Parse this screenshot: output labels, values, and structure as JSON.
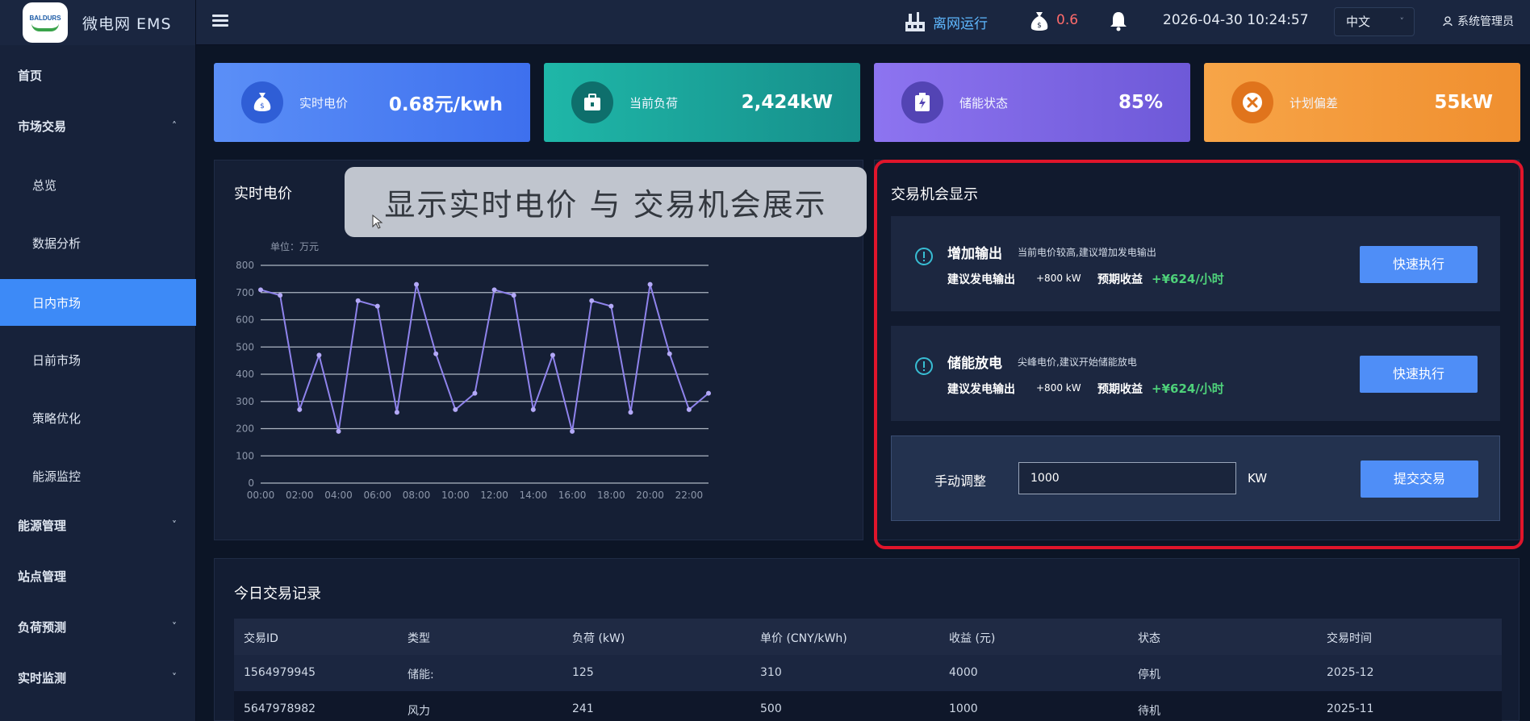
{
  "brand": {
    "logo_text": "BALDURS",
    "title": "微电网 EMS"
  },
  "header": {
    "status": "离网运行",
    "value": "0.6",
    "datetime": "2026-04-30 10:24:57",
    "language": "中文",
    "user": "系统管理员",
    "icons": [
      "menu-icon",
      "power-grid-icon",
      "money-bag-icon",
      "bell-icon",
      "chevron-down-icon",
      "user-icon"
    ]
  },
  "sidebar": {
    "items": [
      {
        "label": "首页"
      },
      {
        "label": "市场交易",
        "arrow": "^"
      },
      {
        "label": "总览"
      },
      {
        "label": "数据分析"
      },
      {
        "label": "日内市场"
      },
      {
        "label": "日前市场"
      },
      {
        "label": "策略优化"
      },
      {
        "label": "能源监控"
      },
      {
        "label": "能源管理",
        "arrow": "v"
      },
      {
        "label": "站点管理"
      },
      {
        "label": "负荷预测",
        "arrow": "v"
      },
      {
        "label": "实时监测",
        "arrow": "v"
      }
    ]
  },
  "kpis": [
    {
      "label": "实时电价",
      "value": "0.68元/kwh",
      "icon": "money-bag-icon",
      "color": "#4a7ef2"
    },
    {
      "label": "当前负荷",
      "value": "2,424kW",
      "icon": "load-box-icon",
      "color": "#1aa69a"
    },
    {
      "label": "储能状态",
      "value": "85%",
      "icon": "battery-bolt-icon",
      "color": "#7c66e4"
    },
    {
      "label": "计划偏差",
      "value": "55kW",
      "icon": "close-circle-icon",
      "color": "#f39a3b"
    }
  ],
  "chart_panel": {
    "title": "实时电价"
  },
  "overlay_caption": "显示实时电价 与 交易机会展示",
  "chart_data": {
    "type": "line",
    "title": "",
    "unit_label": "单位：万元",
    "xlabel": "",
    "ylabel": "",
    "ylim": [
      0,
      800
    ],
    "y_ticks": [
      0,
      100,
      200,
      300,
      400,
      500,
      600,
      700,
      800
    ],
    "x_ticks": [
      "00:00",
      "02:00",
      "04:00",
      "06:00",
      "08:00",
      "10:00",
      "12:00",
      "14:00",
      "16:00",
      "18:00",
      "20:00",
      "22:00"
    ],
    "x_range": [
      0,
      23
    ],
    "grid": true,
    "color": "#8f83ec",
    "series": [
      {
        "x": [
          0,
          1,
          2,
          3,
          4,
          5,
          6,
          7,
          8,
          9,
          10,
          11,
          12,
          13,
          14,
          15,
          16,
          17,
          18,
          19,
          20,
          21,
          22,
          23
        ],
        "values": [
          710,
          690,
          270,
          470,
          190,
          670,
          650,
          260,
          730,
          475,
          270,
          330,
          710,
          690,
          270,
          470,
          190,
          670,
          650,
          260,
          730,
          475,
          270,
          330
        ]
      }
    ]
  },
  "opportunities": {
    "title": "交易机会显示",
    "cards": [
      {
        "title": "增加输出",
        "desc": "当前电价较高,建议增加发电输出",
        "label1": "建议发电输出",
        "value1": "+800 kW",
        "label2": "预期收益",
        "value2": "+¥624/小时",
        "button": "快速执行"
      },
      {
        "title": "储能放电",
        "desc": "尖峰电价,建议开始储能放电",
        "label1": "建议发电输出",
        "value1": "+800 kW",
        "label2": "预期收益",
        "value2": "+¥624/小时",
        "button": "快速执行"
      }
    ],
    "manual": {
      "label": "手动调整",
      "value": "1000",
      "unit": "KW",
      "button": "提交交易"
    }
  },
  "records": {
    "title": "今日交易记录",
    "columns": [
      "交易ID",
      "类型",
      "负荷 (kW)",
      "单价 (CNY/kWh)",
      "收益 (元)",
      "状态",
      "交易时间"
    ],
    "rows": [
      [
        "1564979945",
        "储能:",
        "125",
        "310",
        "4000",
        "停机",
        "2025-12"
      ],
      [
        "5647978982",
        "风力",
        "241",
        "500",
        "1000",
        "待机",
        "2025-11"
      ]
    ]
  },
  "colors": {
    "accent": "#3d8af7",
    "highlight": "#e0152b",
    "positive": "#4ed17a",
    "alert": "#ff6b6b"
  }
}
